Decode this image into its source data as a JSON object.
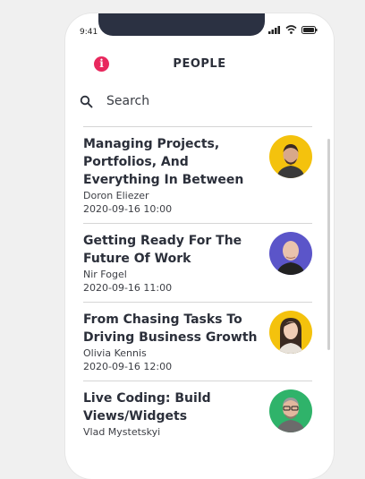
{
  "status_bar": {
    "time": "9:41"
  },
  "header": {
    "title": "PEOPLE",
    "info_icon": "info-icon",
    "info_color": "#e8285d"
  },
  "search": {
    "placeholder": "Search"
  },
  "items": [
    {
      "title": "Managing Projects, Portfolios, And Everything In Between",
      "person": "Doron Eliezer",
      "datetime": "2020-09-16 10:00",
      "avatar_bg": "#f4c20d"
    },
    {
      "title": "Getting Ready For The Future Of Work",
      "person": "Nir Fogel",
      "datetime": "2020-09-16 11:00",
      "avatar_bg": "#5b55c9"
    },
    {
      "title": "From Chasing Tasks To Driving Business Growth",
      "person": "Olivia Kennis",
      "datetime": "2020-09-16 12:00",
      "avatar_bg": "#f4c20d"
    },
    {
      "title": "Live Coding: Build Views/Widgets",
      "person": "Vlad Mystetskyi",
      "datetime": "",
      "avatar_bg": "#2fb36a"
    }
  ]
}
